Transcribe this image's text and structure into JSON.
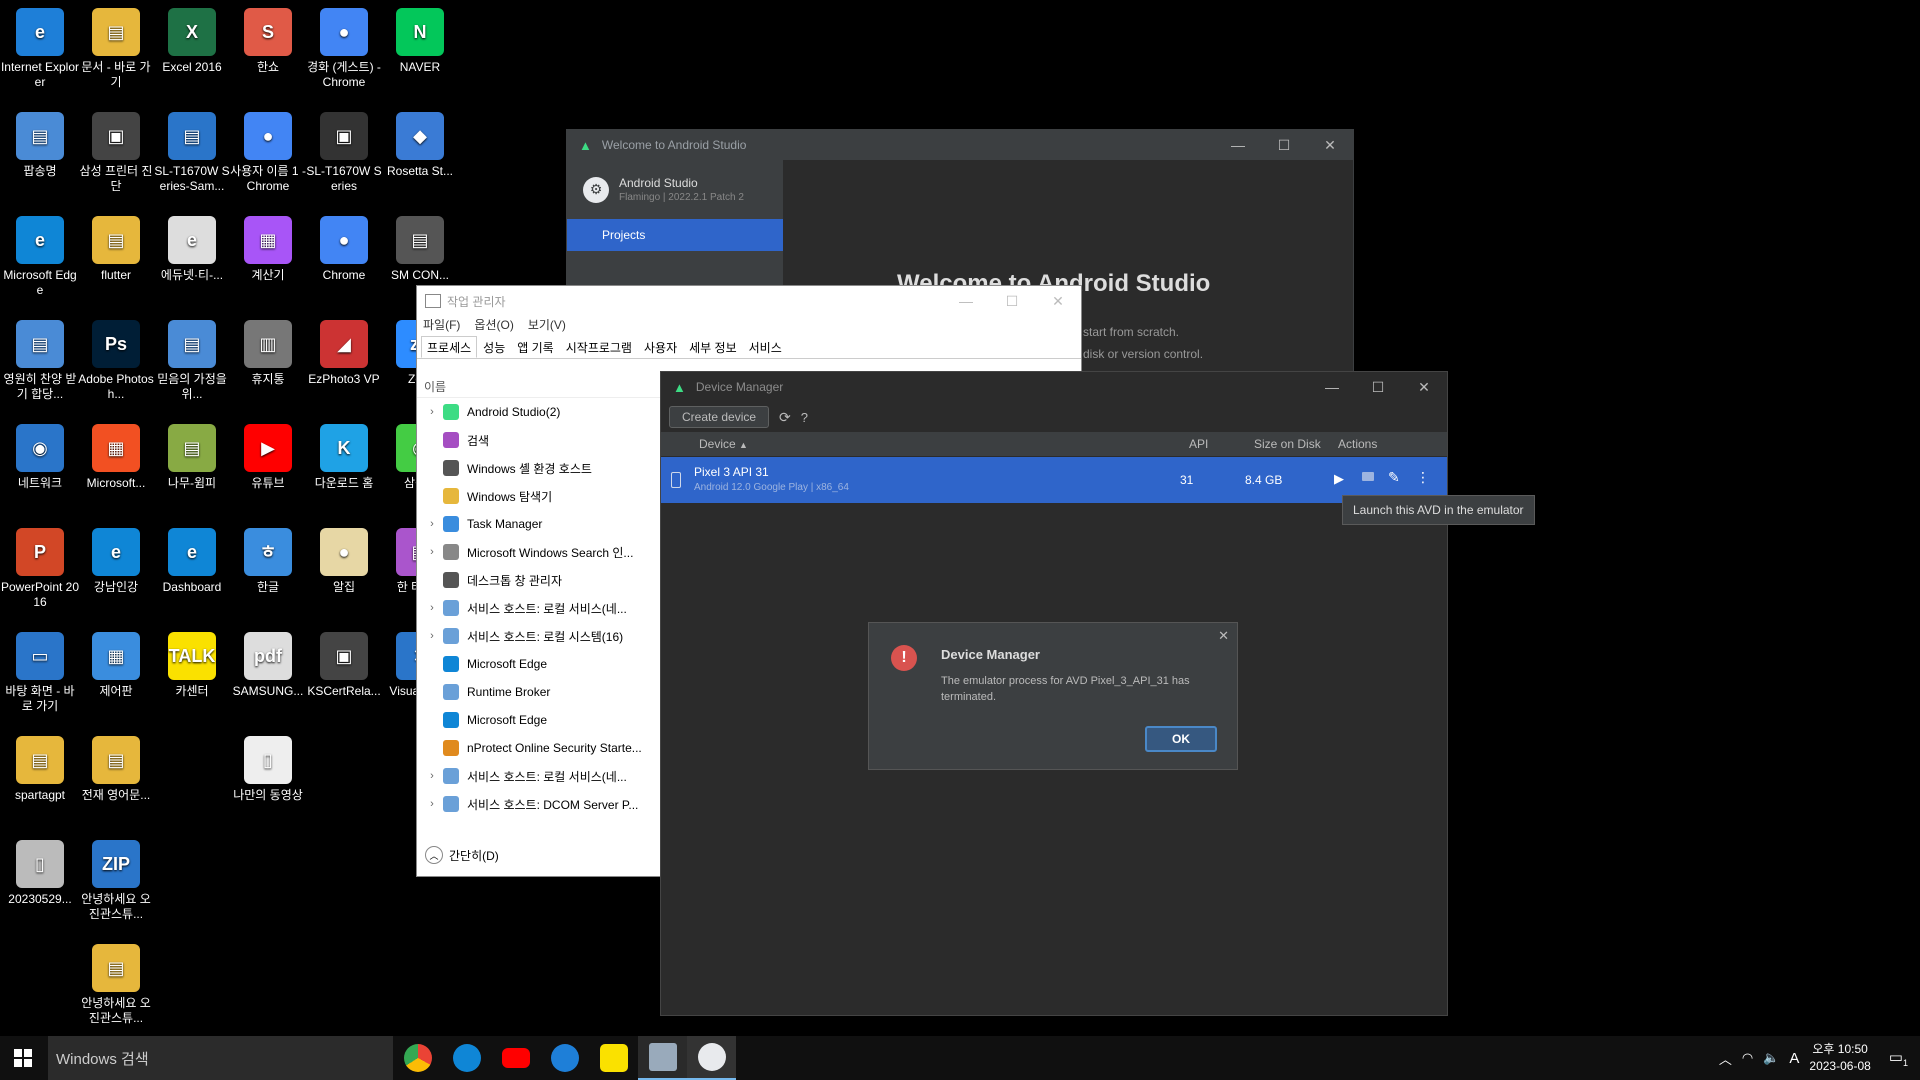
{
  "desktop": {
    "icons": [
      {
        "label": "Internet Explorer",
        "color": "#1e7fd8",
        "glyph": "e"
      },
      {
        "label": "문서 - 바로 가기",
        "color": "#e6b73c",
        "glyph": "▤"
      },
      {
        "label": "Excel 2016",
        "color": "#1e7145",
        "glyph": "X"
      },
      {
        "label": "한쇼",
        "color": "#e05a47",
        "glyph": "S"
      },
      {
        "label": "경화 (게스트) - Chrome",
        "color": "#4285f4",
        "glyph": "●"
      },
      {
        "label": "팝송명",
        "color": "#4a8bd6",
        "glyph": "▤"
      },
      {
        "label": "삼성 프린터 진단",
        "color": "#444",
        "glyph": "▣"
      },
      {
        "label": "SL-T1670W Series-Sam...",
        "color": "#2a75c9",
        "glyph": "▤"
      },
      {
        "label": "사용자 이름 1 - Chrome",
        "color": "#4285f4",
        "glyph": "●"
      },
      {
        "label": "SL-T1670W Series",
        "color": "#333",
        "glyph": "▣"
      },
      {
        "label": "NAVER",
        "color": "#03c75a",
        "glyph": "N"
      },
      {
        "label": "Microsoft Edge",
        "color": "#0f86d6",
        "glyph": "e"
      },
      {
        "label": "flutter",
        "color": "#e6b73c",
        "glyph": "▤"
      },
      {
        "label": "에듀넷·티-...",
        "color": "#ddd",
        "glyph": "e"
      },
      {
        "label": "계산기",
        "color": "#a855f7",
        "glyph": "▦"
      },
      {
        "label": "Chrome",
        "color": "#4285f4",
        "glyph": "●"
      },
      {
        "label": "Rosetta St...",
        "color": "#3a7bd5",
        "glyph": "◆"
      },
      {
        "label": "영원히 찬양 받기 합당...",
        "color": "#4a8bd6",
        "glyph": "▤"
      },
      {
        "label": "Adobe Photosh...",
        "color": "#001e36",
        "glyph": "Ps"
      },
      {
        "label": "믿음의 가정을 위...",
        "color": "#4a8bd6",
        "glyph": "▤"
      },
      {
        "label": "휴지통",
        "color": "#777",
        "glyph": "▥"
      },
      {
        "label": "EzPhoto3 VP",
        "color": "#c33",
        "glyph": "◢"
      },
      {
        "label": "SM CON...",
        "color": "#555",
        "glyph": "▤"
      },
      {
        "label": "네트워크",
        "color": "#2a75c9",
        "glyph": "◉"
      },
      {
        "label": "Microsoft...",
        "color": "#f25022",
        "glyph": "▦"
      },
      {
        "label": "유튜브",
        "color": "#ff0000",
        "glyph": "▶"
      },
      {
        "label": "다운로드 홈",
        "color": "#1fa2e5",
        "glyph": "K"
      },
      {
        "label": "Zo...",
        "color": "#2d8cff",
        "glyph": "zo"
      },
      {
        "label": "강남인강",
        "color": "#0f86d6",
        "glyph": "e"
      },
      {
        "label": "나무-윔피",
        "color": "#8a4",
        "glyph": "▤"
      },
      {
        "label": "한글",
        "color": "#3a8dde",
        "glyph": "ㅎ"
      },
      {
        "label": "알집",
        "color": "#e7d7a5",
        "glyph": "●"
      },
      {
        "label": "삼성...",
        "color": "#4c4",
        "glyph": "◉"
      },
      {
        "label": "PowerPoint 2016",
        "color": "#d24726",
        "glyph": "P"
      },
      {
        "label": "제어판",
        "color": "#3a8dde",
        "glyph": "▦"
      },
      {
        "label": "Dashboard",
        "color": "#0f86d6",
        "glyph": "e"
      },
      {
        "label": "SAMSUNG...",
        "color": "#ddd",
        "glyph": "pdf"
      },
      {
        "label": "KSCertRela...",
        "color": "#444",
        "glyph": "▣"
      },
      {
        "label": "한 타자...",
        "color": "#a5c",
        "glyph": "▤"
      },
      {
        "label": "바탕 화면 - 바로 가기",
        "color": "#2a75c9",
        "glyph": "▭"
      },
      {
        "label": "전재 영어문...",
        "color": "#e6b73c",
        "glyph": "▤"
      },
      {
        "label": "카센터",
        "color": "#fae100",
        "glyph": "TALK"
      },
      {
        "label": "나만의 동영상",
        "color": "#eee",
        "glyph": "▯"
      },
      {
        "label": "Visual Co...",
        "color": "#2a75c9",
        "glyph": "✕"
      },
      {
        "label": "spartagpt",
        "color": "#e6b73c",
        "glyph": "▤"
      },
      {
        "label": "안녕하세요 오진관스튜...",
        "color": "#2a75c9",
        "glyph": "ZIP"
      },
      {
        "label": "20230529...",
        "color": "#bbb",
        "glyph": "▯"
      },
      {
        "label": "안녕하세요 오진관스튜...",
        "color": "#e6b73c",
        "glyph": "▤"
      }
    ]
  },
  "welcome": {
    "title": "Welcome to Android Studio",
    "app_name": "Android Studio",
    "version": "Flamingo | 2022.2.1 Patch 2",
    "nav_projects": "Projects",
    "heading": "Welcome to Android Studio",
    "line1": "start from scratch.",
    "line2": "disk or version control."
  },
  "taskmgr": {
    "title": "작업 관리자",
    "menu": [
      "파일(F)",
      "옵션(O)",
      "보기(V)"
    ],
    "tabs": [
      "프로세스",
      "성능",
      "앱 기록",
      "시작프로그램",
      "사용자",
      "세부 정보",
      "서비스"
    ],
    "col_name": "이름",
    "processes": [
      {
        "name": "Android Studio(2)",
        "expand": true,
        "color": "#3ddc84"
      },
      {
        "name": "검색",
        "expand": false,
        "color": "#a54ec2"
      },
      {
        "name": "Windows 셸 환경 호스트",
        "expand": false,
        "color": "#555"
      },
      {
        "name": "Windows 탐색기",
        "expand": false,
        "color": "#e6b73c"
      },
      {
        "name": "Task Manager",
        "expand": true,
        "color": "#3a8dde"
      },
      {
        "name": "Microsoft Windows Search 인...",
        "expand": true,
        "color": "#888"
      },
      {
        "name": "데스크톱 창 관리자",
        "expand": false,
        "color": "#555"
      },
      {
        "name": "서비스 호스트: 로컬 서비스(네...",
        "expand": true,
        "color": "#6aa0d8"
      },
      {
        "name": "서비스 호스트: 로컬 시스템(16)",
        "expand": true,
        "color": "#6aa0d8"
      },
      {
        "name": "Microsoft Edge",
        "expand": false,
        "color": "#0f86d6"
      },
      {
        "name": "Runtime Broker",
        "expand": false,
        "color": "#6aa0d8"
      },
      {
        "name": "Microsoft Edge",
        "expand": false,
        "color": "#0f86d6"
      },
      {
        "name": "nProtect Online Security Starte...",
        "expand": false,
        "color": "#e08a1e"
      },
      {
        "name": "서비스 호스트: 로컬 서비스(네...",
        "expand": true,
        "color": "#6aa0d8"
      },
      {
        "name": "서비스 호스트: DCOM Server P...",
        "expand": true,
        "color": "#6aa0d8"
      }
    ],
    "fewer_details": "간단히(D)"
  },
  "devmgr": {
    "title": "Device Manager",
    "create_device": "Create device",
    "help": "?",
    "col_device": "Device",
    "col_api": "API",
    "col_size": "Size on Disk",
    "col_actions": "Actions",
    "device_name": "Pixel 3 API 31",
    "device_sub": "Android 12.0 Google Play | x86_64",
    "device_api": "31",
    "device_size": "8.4 GB"
  },
  "tooltip": "Launch this AVD in the emulator",
  "dialog": {
    "title": "Device Manager",
    "message": "The emulator process for AVD Pixel_3_API_31 has terminated.",
    "ok": "OK"
  },
  "taskbar": {
    "search_placeholder": "Windows 검색",
    "time": "오후 10:50",
    "date": "2023-06-08",
    "ime": "A",
    "notif_count": "1"
  }
}
